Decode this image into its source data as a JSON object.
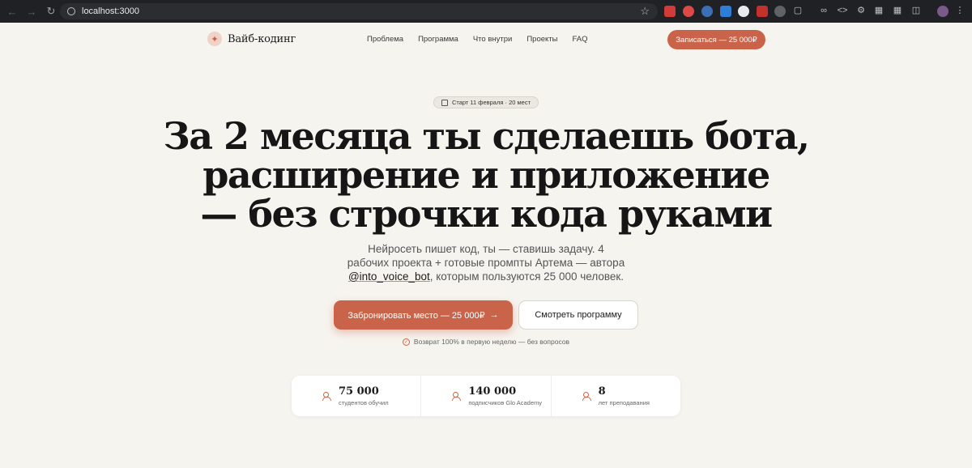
{
  "browser": {
    "url": "localhost:3000",
    "back_icon": "arrow-left-icon",
    "forward_icon": "arrow-right-icon",
    "reload_icon": "reload-icon"
  },
  "header": {
    "logo_text": "Вайб-кодинг",
    "nav": [
      "Проблема",
      "Программа",
      "Что внутри",
      "Проекты",
      "FAQ"
    ],
    "cta": "Записаться — 25 000₽"
  },
  "hero": {
    "badge": "Старт 11 февраля · 20 мест",
    "headline_line1": "За 2 месяца ты сделаешь бота,",
    "headline_line2": "расширение и приложение",
    "headline_line3": "— без строчки кода руками",
    "sub_line1": "Нейросеть пишет код, ты — ставишь задачу. 4",
    "sub_line2": "рабочих проекта + готовые промпты Артема — автора",
    "sub_handle": "@into_voice_bot",
    "sub_line3_rest": ", которым пользуются 25 000 человек.",
    "primary_button": "Забронировать место — 25 000₽",
    "secondary_button": "Смотреть программу",
    "refund_note": "Возврат 100% в первую неделю — без вопросов"
  },
  "stats": [
    {
      "value": "75 000",
      "label": "студентов обучил"
    },
    {
      "value": "140 000",
      "label": "подписчиков Glo Academy"
    },
    {
      "value": "8",
      "label": "лет преподавания"
    }
  ],
  "colors": {
    "accent": "#c9644a",
    "background": "#f6f4ef"
  }
}
